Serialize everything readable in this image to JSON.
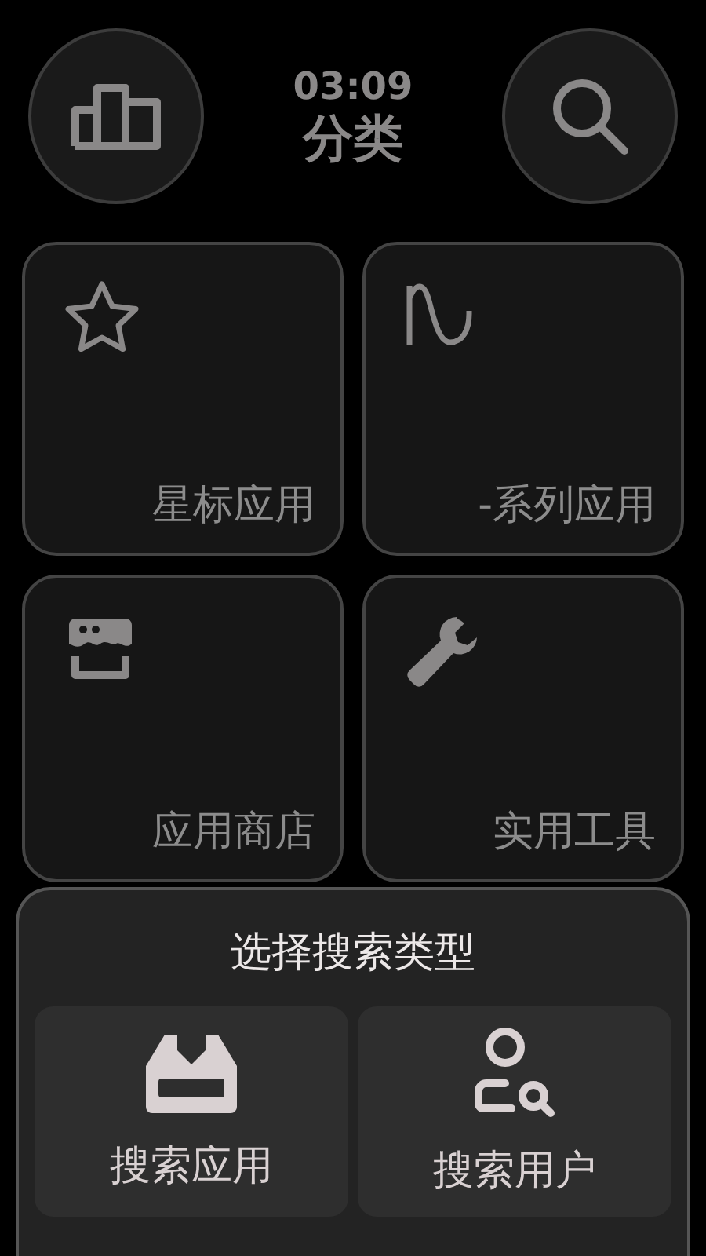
{
  "header": {
    "time": "03:09",
    "title": "分类"
  },
  "tiles": [
    {
      "label": "星标应用"
    },
    {
      "label": "-系列应用"
    },
    {
      "label": "应用商店"
    },
    {
      "label": "实用工具"
    }
  ],
  "search_sheet": {
    "title": "选择搜索类型",
    "options": [
      {
        "label": "搜索应用"
      },
      {
        "label": "搜索用户"
      }
    ]
  }
}
